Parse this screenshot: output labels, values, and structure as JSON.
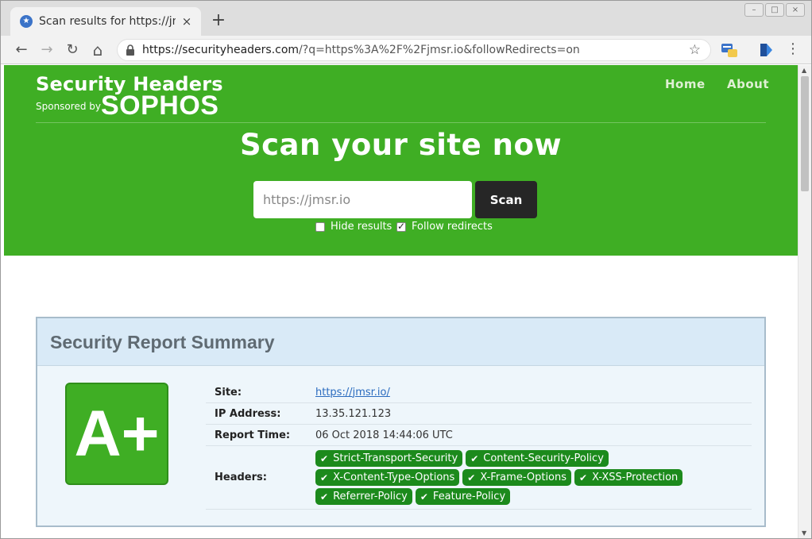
{
  "browser": {
    "tab_title": "Scan results for https://jm",
    "tab_close": "×",
    "new_tab": "+",
    "window_controls": [
      "–",
      "□",
      "×"
    ],
    "url_host": "https://securityheaders.com",
    "url_path": "/?q=https%3A%2F%2Fjmsr.io&followRedirects=on",
    "nav": {
      "back": "←",
      "forward": "→",
      "reload": "↻",
      "home": "⌂"
    },
    "bookmark_icon": "star-icon",
    "menu": "⋮"
  },
  "site": {
    "brand_title": "Security Headers",
    "sponsored_by": "Sponsored by",
    "sponsor_name": "SOPHOS",
    "nav": [
      {
        "label": "Home"
      },
      {
        "label": "About"
      }
    ],
    "heading": "Scan your site now",
    "search": {
      "value": "",
      "placeholder": "https://jmsr.io"
    },
    "scan_button": "Scan",
    "options": [
      {
        "label": "Hide results",
        "checked": false
      },
      {
        "label": "Follow redirects",
        "checked": true
      }
    ]
  },
  "report": {
    "title": "Security Report Summary",
    "grade": "A+",
    "rows": {
      "site": {
        "label": "Site:",
        "value": "https://jmsr.io/"
      },
      "ip": {
        "label": "IP Address:",
        "value": "13.35.121.123"
      },
      "time": {
        "label": "Report Time:",
        "value": "06 Oct 2018 14:44:06 UTC"
      },
      "headers": {
        "label": "Headers:"
      }
    },
    "headers": [
      "Strict-Transport-Security",
      "Content-Security-Policy",
      "X-Content-Type-Options",
      "X-Frame-Options",
      "X-XSS-Protection",
      "Referrer-Policy",
      "Feature-Policy"
    ]
  },
  "colors": {
    "brand_green": "#3fae24",
    "pill_green": "#1c8a1c",
    "scan_button": "#262626",
    "report_header": "#d9eaf7"
  }
}
